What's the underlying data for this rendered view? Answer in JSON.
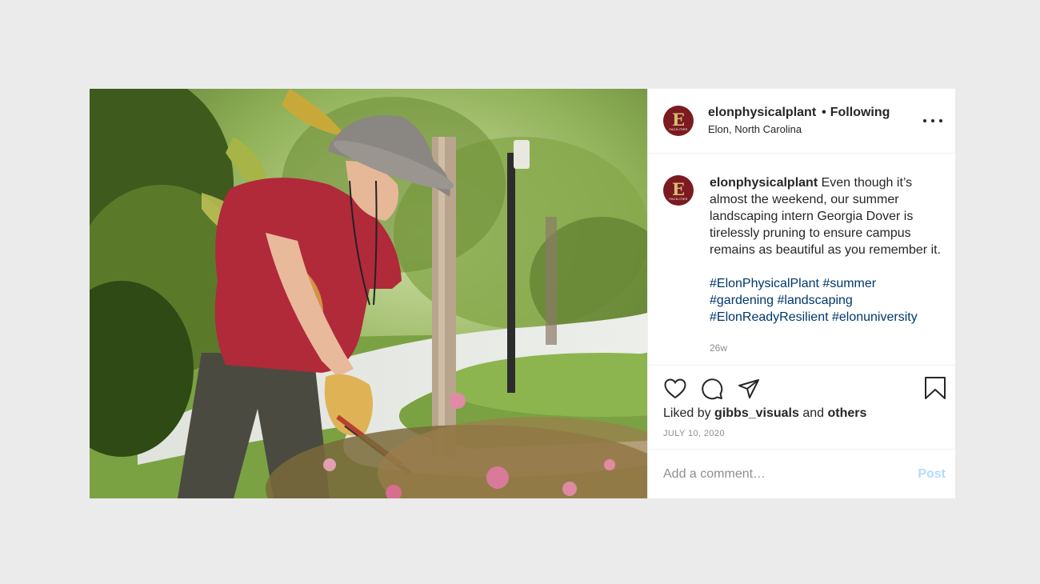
{
  "post": {
    "author": {
      "username": "elonphysicalplant",
      "follow_status": "Following",
      "separator": "•",
      "location": "Elon, North Carolina",
      "avatar_letter": "E",
      "avatar_sub": "FACILITIES"
    },
    "caption": {
      "username": "elonphysicalplant",
      "text": "Even though it’s almost the weekend, our summer landscaping intern Georgia Dover is tirelessly pruning to ensure campus remains as beautiful as you remember it.",
      "hashtags": [
        "#ElonPhysicalPlant",
        "#summer",
        "#gardening",
        "#landscaping",
        "#ElonReadyResilient",
        "#elonuniversity"
      ],
      "age": "26w"
    },
    "likes": {
      "prefix": "Liked by",
      "user": "gibbs_visuals",
      "joiner": "and",
      "others": "others"
    },
    "date": "JULY 10, 2020",
    "comment": {
      "placeholder": "Add a comment…",
      "post_label": "Post"
    }
  },
  "icons": {
    "like": "heart-icon",
    "comment": "comment-icon",
    "share": "share-icon",
    "save": "bookmark-icon",
    "more": "more-options-icon"
  },
  "colors": {
    "brand": "#7b1a20",
    "hashtag": "#00376b",
    "post_button_disabled": "#b3dbff",
    "background": "#ebebeb"
  }
}
